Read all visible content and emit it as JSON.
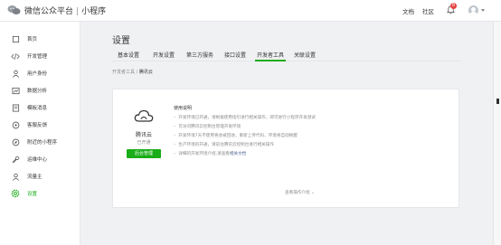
{
  "brand": {
    "name": "微信公众平台",
    "separator": "|",
    "product": "小程序"
  },
  "topbar": {
    "docs": "文档",
    "community": "社区",
    "notification_count": "8"
  },
  "sidebar": {
    "items": [
      {
        "label": "首页",
        "icon": "home-icon"
      },
      {
        "label": "开发管理",
        "icon": "code-icon"
      },
      {
        "label": "用户身份",
        "icon": "user-icon"
      },
      {
        "label": "数据分析",
        "icon": "chart-icon"
      },
      {
        "label": "模板消息",
        "icon": "template-icon"
      },
      {
        "label": "客服反馈",
        "icon": "headset-icon"
      },
      {
        "label": "附近的小程序",
        "icon": "location-icon"
      },
      {
        "label": "运维中心",
        "icon": "wrench-icon"
      },
      {
        "label": "流量主",
        "icon": "account-icon"
      },
      {
        "label": "设置",
        "icon": "gear-icon"
      }
    ],
    "active_index": 9
  },
  "page": {
    "title": "设置"
  },
  "tabs": [
    "基本设置",
    "开发设置",
    "第三方服务",
    "接口设置",
    "开发者工具",
    "关联设置"
  ],
  "active_tab": "开发者工具",
  "breadcrumb": {
    "parent": "开发者工具",
    "separator": "/",
    "current": "腾讯云"
  },
  "service": {
    "name": "腾讯云",
    "status": "已开通",
    "button": "后台管理"
  },
  "instructions": {
    "title": "使用说明",
    "items": [
      "开发环境已开通，请根据使用指引进行相关操作，即可进行小程序开发测试",
      "可访问腾讯云控制台管理开发环境",
      "开发环境7天不使用将会被回收，重新上传代码，环境将自动唤醒",
      "生产环境的开通，请前往腾讯云控制台进行相关操作",
      "详细的开发环境介绍,请查看"
    ],
    "doc_link": "相关文档",
    "more": "查看操作介绍"
  },
  "colors": {
    "accent": "#1aad19",
    "link": "#576b95",
    "badge": "#e64340"
  }
}
